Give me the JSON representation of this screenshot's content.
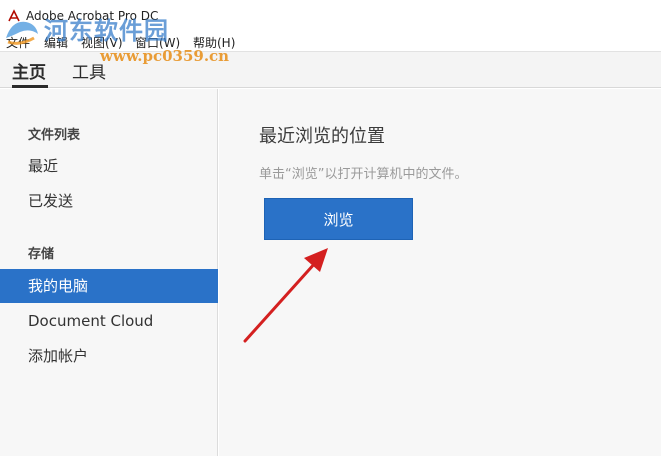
{
  "window": {
    "title": "Adobe Acrobat Pro DC"
  },
  "watermark": {
    "text": "河东软件园",
    "url": "www.pc0359.cn"
  },
  "menu": {
    "items": [
      {
        "label": "文件"
      },
      {
        "label": "编辑"
      },
      {
        "label": "视图(V)"
      },
      {
        "label": "窗口(W)"
      },
      {
        "label": "帮助(H)"
      }
    ]
  },
  "tabs": [
    {
      "label": "主页",
      "active": true
    },
    {
      "label": "工具",
      "active": false
    }
  ],
  "sidebar": {
    "files_section": "文件列表",
    "files_items": [
      {
        "label": "最近"
      },
      {
        "label": "已发送"
      }
    ],
    "storage_section": "存储",
    "storage_items": [
      {
        "label": "我的电脑",
        "selected": true
      },
      {
        "label": "Document Cloud",
        "selected": false
      },
      {
        "label": "添加帐户",
        "selected": false
      }
    ]
  },
  "main": {
    "heading": "最近浏览的位置",
    "hint": "单击“浏览”以打开计算机中的文件。",
    "browse_button": "浏览"
  },
  "colors": {
    "accent": "#2a72c8",
    "annotation_arrow": "#d42020"
  },
  "icons": {
    "app": "acrobat-icon",
    "annotation": "red-arrow-icon"
  }
}
